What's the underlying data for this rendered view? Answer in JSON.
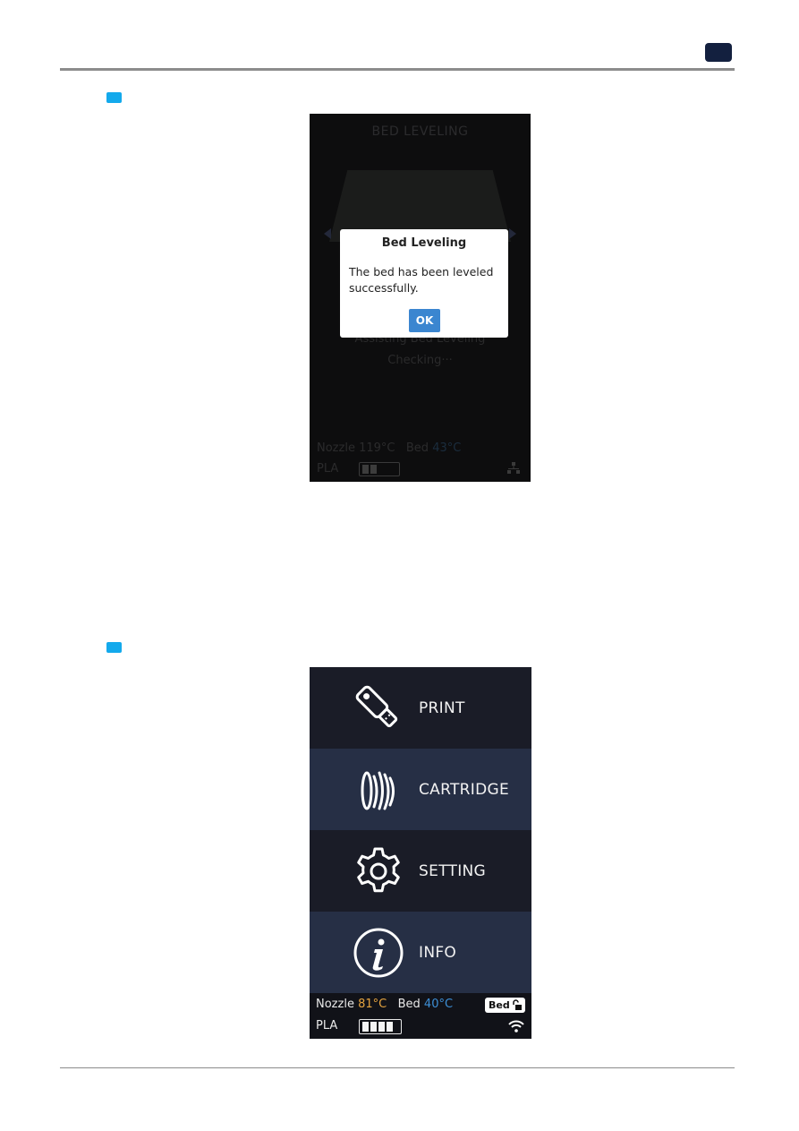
{
  "colors": {
    "page_tab": "#13203f",
    "step_marker": "#13a9ec",
    "ok_button": "#3b86d0",
    "nozzle_temp": "#e3a23f",
    "bed_temp": "#3d8fd6",
    "menu_dark": "#1a1c27",
    "menu_light": "#262f45"
  },
  "screen1": {
    "title": "BED LEVELING",
    "status_line1": "Assisting Bed Leveling",
    "status_line2": "Checking···",
    "nozzle_label": "Nozzle",
    "nozzle_value": "119°C",
    "bed_label": "Bed",
    "bed_value": "43°C",
    "material": "PLA",
    "filament_level": 0.5,
    "network_icon": "ethernet-icon",
    "dialog": {
      "title": "Bed Leveling",
      "message": "The bed has been leveled successfully.",
      "ok_label": "OK"
    }
  },
  "screen2": {
    "menu": [
      {
        "label": "PRINT",
        "icon": "usb-drive-icon"
      },
      {
        "label": "CARTRIDGE",
        "icon": "filament-spool-icon"
      },
      {
        "label": "SETTING",
        "icon": "gear-icon"
      },
      {
        "label": "INFO",
        "icon": "info-icon"
      }
    ],
    "status": {
      "nozzle_label": "Nozzle",
      "nozzle_value": "81°C",
      "bed_label": "Bed",
      "bed_value": "40°C",
      "bed_lock_label": "Bed",
      "bed_lock_icon": "unlock-icon",
      "material": "PLA",
      "filament_level": 1.0,
      "network_icon": "wifi-icon"
    }
  }
}
